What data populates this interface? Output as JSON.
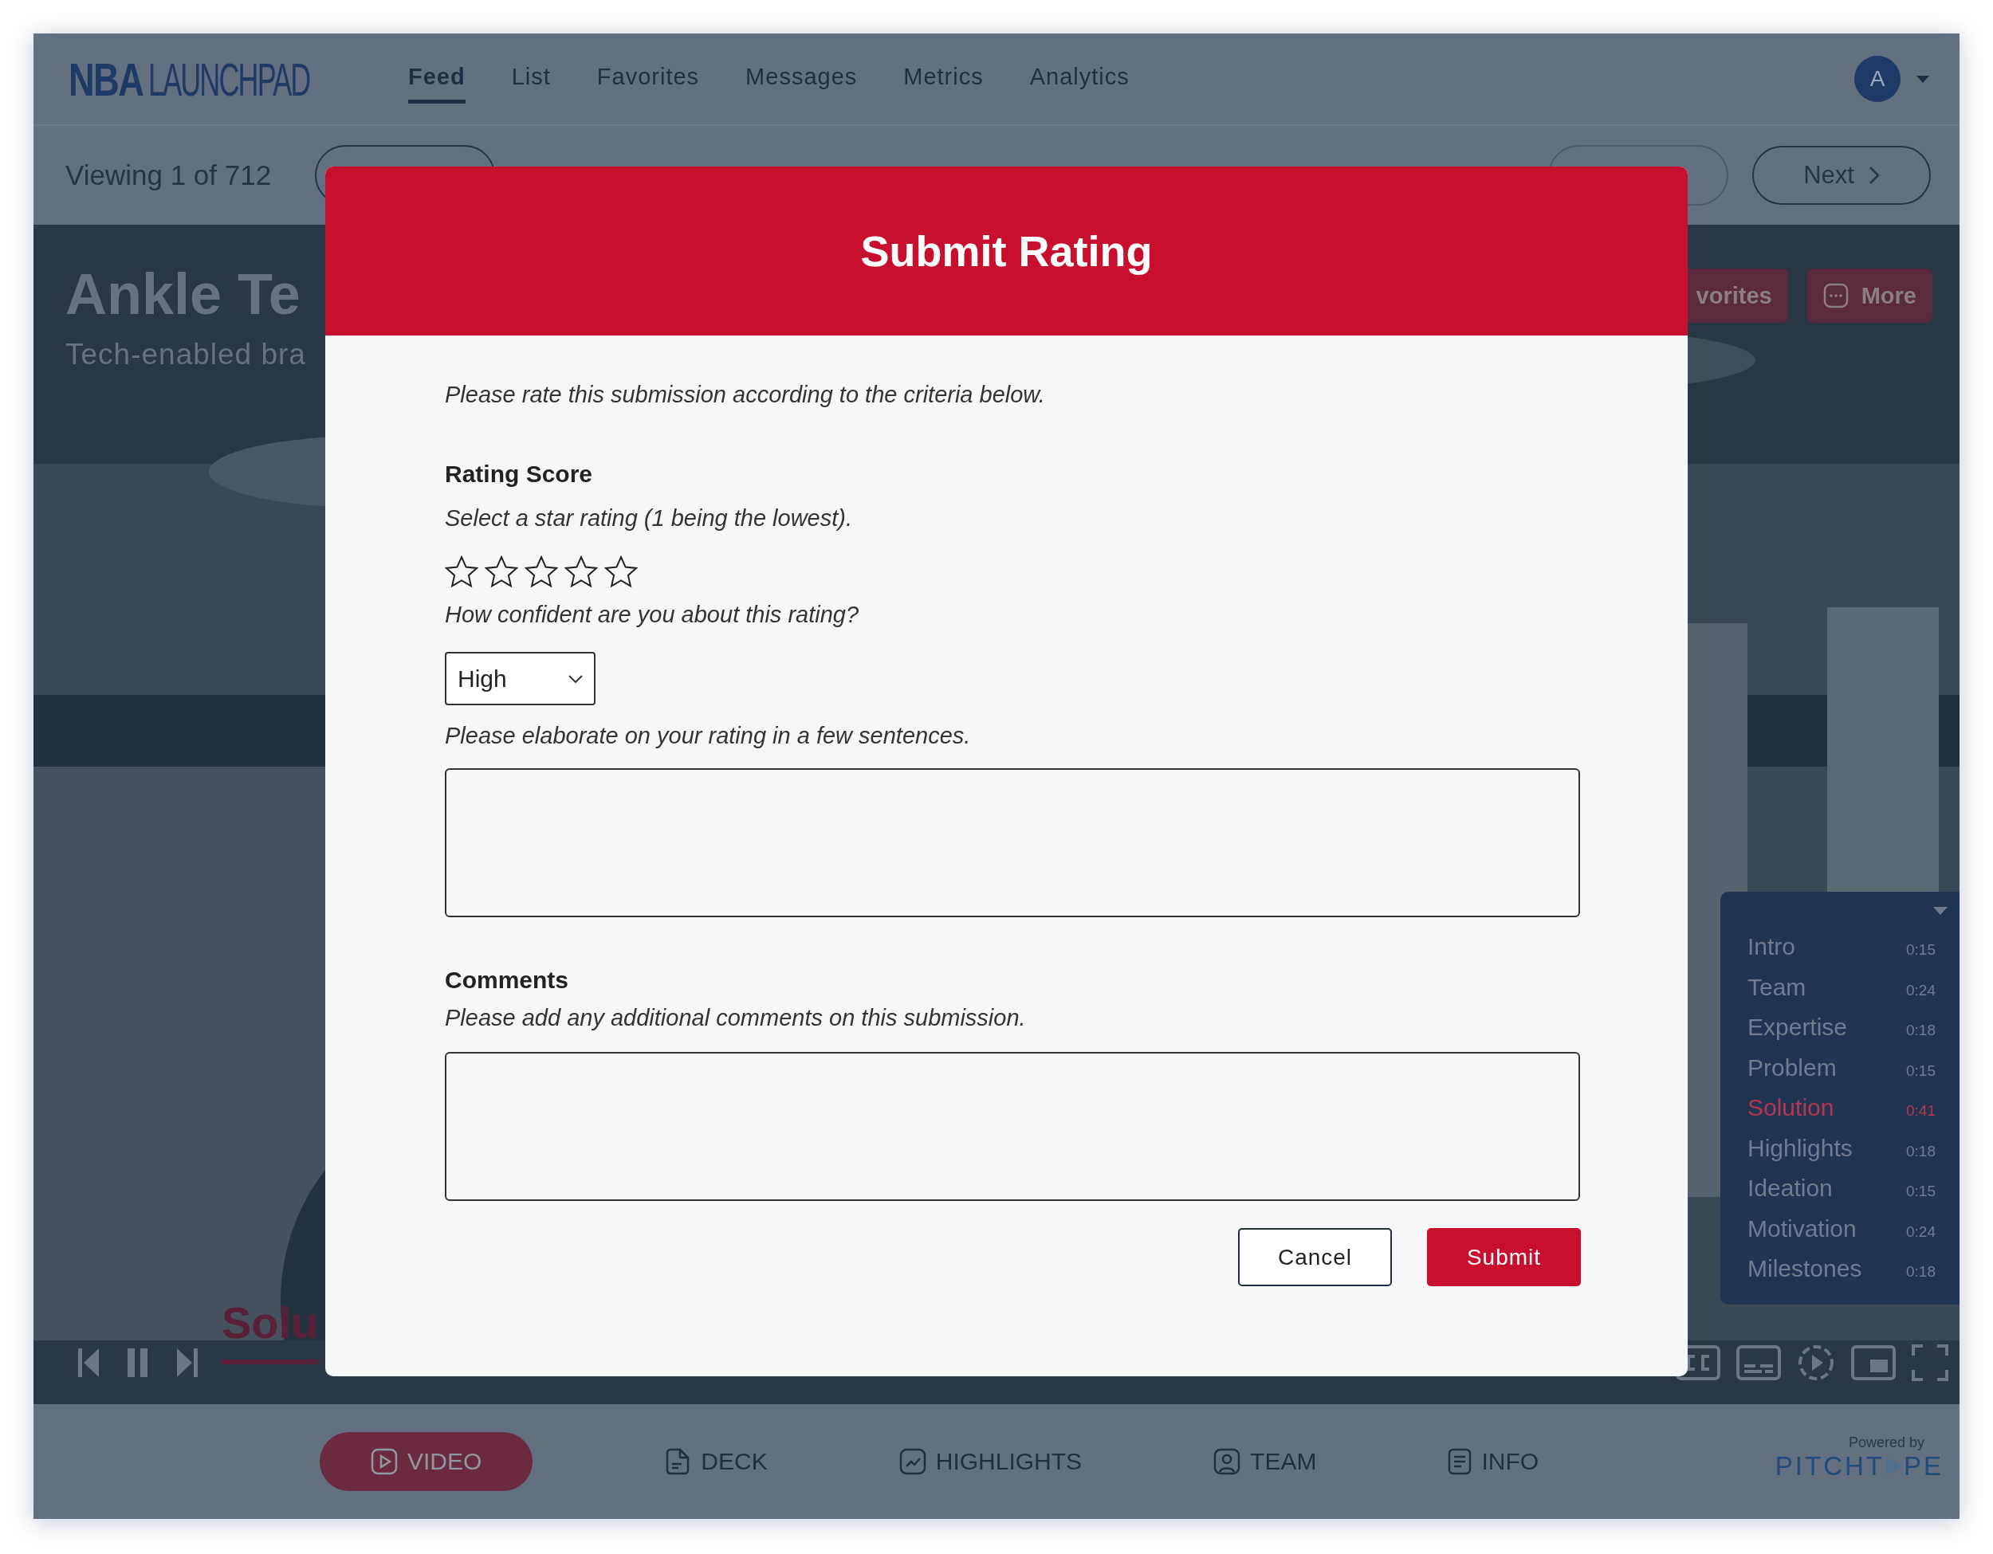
{
  "header": {
    "logo": {
      "brand": "NBA",
      "product": "LAUNCHPAD"
    },
    "nav": [
      {
        "label": "Feed",
        "selected": true
      },
      {
        "label": "List",
        "selected": false
      },
      {
        "label": "Favorites",
        "selected": false
      },
      {
        "label": "Messages",
        "selected": false
      },
      {
        "label": "Metrics",
        "selected": false
      },
      {
        "label": "Analytics",
        "selected": false
      }
    ],
    "avatar": "A"
  },
  "toolbar": {
    "count": "Viewing 1 of 712",
    "next": "Next"
  },
  "hero": {
    "title": "Ankle Te",
    "subtitle": "Tech-enabled bra",
    "actions": [
      {
        "label": "vorites",
        "kind": "plain"
      },
      {
        "label": "More",
        "kind": "more"
      }
    ]
  },
  "chapters": [
    {
      "name": "Intro",
      "time": "0:15",
      "selected": false
    },
    {
      "name": "Team",
      "time": "0:24",
      "selected": false
    },
    {
      "name": "Expertise",
      "time": "0:18",
      "selected": false
    },
    {
      "name": "Problem",
      "time": "0:15",
      "selected": false
    },
    {
      "name": "Solution",
      "time": "0:41",
      "selected": true
    },
    {
      "name": "Highlights",
      "time": "0:18",
      "selected": false
    },
    {
      "name": "Ideation",
      "time": "0:15",
      "selected": false
    },
    {
      "name": "Motivation",
      "time": "0:24",
      "selected": false
    },
    {
      "name": "Milestones",
      "time": "0:18",
      "selected": false
    }
  ],
  "current_chapter": {
    "name": "Solu"
  },
  "bottom_tabs": [
    {
      "label": "VIDEO",
      "kind": "video",
      "selected": true
    },
    {
      "label": "DECK",
      "kind": "deck",
      "selected": false
    },
    {
      "label": "HIGHLIGHTS",
      "kind": "highlights",
      "selected": false
    },
    {
      "label": "TEAM",
      "kind": "team",
      "selected": false
    },
    {
      "label": "INFO",
      "kind": "info",
      "selected": false
    }
  ],
  "powered": {
    "label": "Powered by",
    "brand_start": "PITCHT",
    "brand_end": "PE"
  },
  "modal": {
    "title": "Submit Rating",
    "intro": "Please rate this submission according to the criteria below.",
    "rating": {
      "heading": "Rating Score",
      "hint": "Select a star rating (1 being the lowest).",
      "stars": 0
    },
    "confidence": {
      "question": "How confident are you about this rating?",
      "value": "High"
    },
    "elaborate": {
      "prompt": "Please elaborate on your rating in a few sentences."
    },
    "comments": {
      "heading": "Comments",
      "hint": "Please add any additional comments on this submission."
    },
    "buttons": {
      "cancel": "Cancel",
      "submit": "Submit"
    }
  }
}
